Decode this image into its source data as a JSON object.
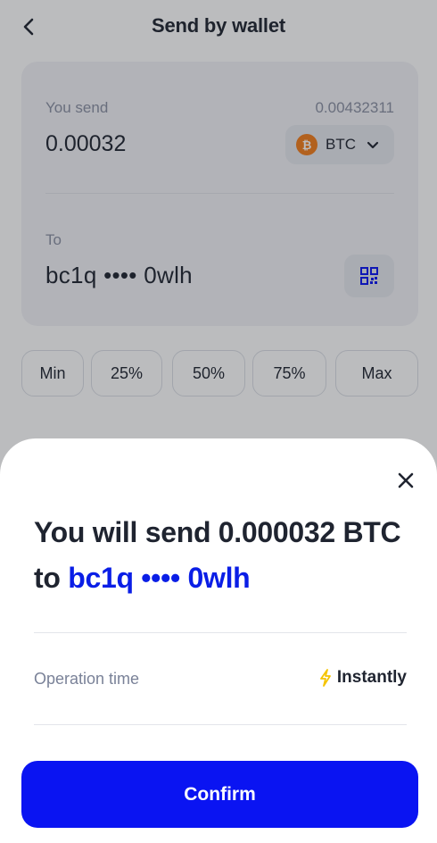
{
  "header": {
    "title": "Send by wallet",
    "back_icon": "chevron-left-icon"
  },
  "send_card": {
    "send_label": "You send",
    "balance": "0.00432311",
    "amount": "0.00032",
    "coin": {
      "symbol": "BTC",
      "icon_glyph": "₿",
      "icon_color": "#f27d1b"
    },
    "to_label": "To",
    "address": "bc1q •••• 0wlh"
  },
  "amount_chips": [
    "Min",
    "25%",
    "50%",
    "75%",
    "Max"
  ],
  "sheet": {
    "title_prefix": "You will send 0.000032 BTC to ",
    "title_address": "bc1q •••• 0wlh",
    "operation_label": "Operation time",
    "operation_value": "Instantly",
    "confirm_label": "Confirm"
  },
  "colors": {
    "accent": "#0a14f2",
    "address_highlight": "#0a1ee6",
    "bolt": "#f5c400"
  }
}
